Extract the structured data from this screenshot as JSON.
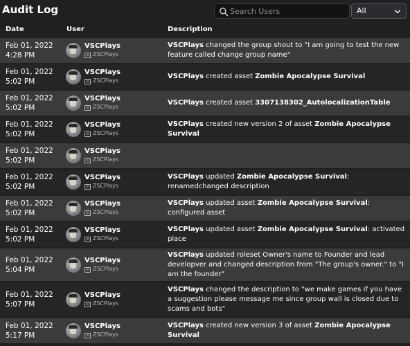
{
  "header": {
    "title": "Audit Log",
    "search_placeholder": "Search Users",
    "filter_value": "All"
  },
  "columns": {
    "date": "Date",
    "user": "User",
    "description": "Description"
  },
  "rows": [
    {
      "date": "Feb 01, 2022",
      "time": "4:28 PM",
      "user": "VSCPlays",
      "handle": "ZSCPlays",
      "description": [
        {
          "text": "VSCPlays",
          "bold": true
        },
        {
          "text": " changed the group shout to \"I am going to test the new feature called change group name\"",
          "bold": false
        }
      ]
    },
    {
      "date": "Feb 01, 2022",
      "time": "5:02 PM",
      "user": "VSCPlays",
      "handle": "ZSCPlays",
      "description": [
        {
          "text": "VSCPlays",
          "bold": true
        },
        {
          "text": " created asset ",
          "bold": false
        },
        {
          "text": "Zombie Apocalypse Survival",
          "bold": true
        }
      ]
    },
    {
      "date": "Feb 01, 2022",
      "time": "5:02 PM",
      "user": "VSCPlays",
      "handle": "ZSCPlays",
      "description": [
        {
          "text": "VSCPlays",
          "bold": true
        },
        {
          "text": " created asset ",
          "bold": false
        },
        {
          "text": "3307138302_AutolocalizationTable",
          "bold": true
        }
      ]
    },
    {
      "date": "Feb 01, 2022",
      "time": "5:02 PM",
      "user": "VSCPlays",
      "handle": "ZSCPlays",
      "description": [
        {
          "text": "VSCPlays",
          "bold": true
        },
        {
          "text": " created new version 2 of asset ",
          "bold": false
        },
        {
          "text": "Zombie Apocalypse Survival",
          "bold": true
        }
      ]
    },
    {
      "date": "Feb 01, 2022",
      "time": "5:02 PM",
      "user": "VSCPlays",
      "handle": "ZSCPlays",
      "description": []
    },
    {
      "date": "Feb 01, 2022",
      "time": "5:02 PM",
      "user": "VSCPlays",
      "handle": "ZSCPlays",
      "description": [
        {
          "text": "VSCPlays",
          "bold": true
        },
        {
          "text": " updated ",
          "bold": false
        },
        {
          "text": "Zombie Apocalypse Survival",
          "bold": true
        },
        {
          "text": ": renamedchanged description",
          "bold": false
        }
      ]
    },
    {
      "date": "Feb 01, 2022",
      "time": "5:02 PM",
      "user": "VSCPlays",
      "handle": "ZSCPlays",
      "description": [
        {
          "text": "VSCPlays",
          "bold": true
        },
        {
          "text": " updated asset ",
          "bold": false
        },
        {
          "text": "Zombie Apocalypse Survival",
          "bold": true
        },
        {
          "text": ": configured asset",
          "bold": false
        }
      ]
    },
    {
      "date": "Feb 01, 2022",
      "time": "5:02 PM",
      "user": "VSCPlays",
      "handle": "ZSCPlays",
      "description": [
        {
          "text": "VSCPlays",
          "bold": true
        },
        {
          "text": " updated asset ",
          "bold": false
        },
        {
          "text": "Zombie Apocalypse Survival",
          "bold": true
        },
        {
          "text": ": activated place",
          "bold": false
        }
      ]
    },
    {
      "date": "Feb 01, 2022",
      "time": "5:04 PM",
      "user": "VSCPlays",
      "handle": "ZSCPlays",
      "description": [
        {
          "text": "VSCPlays",
          "bold": true
        },
        {
          "text": " updated roleset Owner's name to Founder and lead developver and changed description from \"The group's owner.\" to \"I am the founder\"",
          "bold": false
        }
      ]
    },
    {
      "date": "Feb 01, 2022",
      "time": "5:07 PM",
      "user": "VSCPlays",
      "handle": "ZSCPlays",
      "description": [
        {
          "text": "VSCPlays",
          "bold": true
        },
        {
          "text": " changed the description to \"we make games if you have a suggestion please message me since group wall is closed due to scams and bots\"",
          "bold": false
        }
      ]
    },
    {
      "date": "Feb 01, 2022",
      "time": "5:17 PM",
      "user": "VSCPlays",
      "handle": "ZSCPlays",
      "description": [
        {
          "text": "VSCPlays",
          "bold": true
        },
        {
          "text": " created new version 3 of asset ",
          "bold": false
        },
        {
          "text": "Zombie Apocalypse Survival",
          "bold": true
        }
      ]
    }
  ]
}
